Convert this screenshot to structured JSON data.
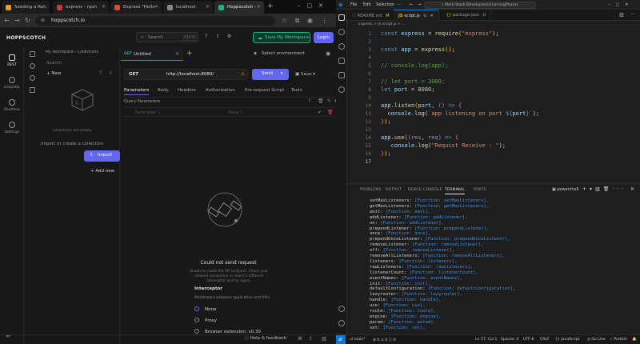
{
  "browser": {
    "tabs": [
      {
        "label": "Seeding a Re..."
      },
      {
        "label": "express - npm"
      },
      {
        "label": "Express \"Hello"
      },
      {
        "label": "localhost"
      },
      {
        "label": "Hoppscotch -"
      }
    ],
    "new_tab": "+",
    "url": "hoppscotch.io"
  },
  "hopp": {
    "logo": "HOPPSCOTCH",
    "search_label": "Search",
    "search_kbd": "Ctrl K",
    "save_workspace": "Save My Workspace",
    "login": "Login",
    "nav": [
      {
        "label": "REST"
      },
      {
        "label": "GraphQL"
      },
      {
        "label": "Realtime"
      },
      {
        "label": "Settings"
      }
    ],
    "collections": {
      "crumb_ws": "My Workspace",
      "crumb_sep": "›",
      "crumb_col": "Collections",
      "search": "Search",
      "new": "New",
      "empty": "Collections are empty",
      "import_create": "Import or create a collection",
      "import_btn": "Import",
      "add_new": "Add new"
    },
    "request": {
      "tab_method": "GET",
      "tab_name": "Untitled",
      "new_tab": "+",
      "env": "Select environment",
      "method": "GET",
      "url": "http://localhost:8080/",
      "send": "Send",
      "save": "Save",
      "tabs": [
        "Parameters",
        "Body",
        "Headers",
        "Authorization",
        "Pre-request Script",
        "Tests"
      ],
      "query_params": "Query Parameters",
      "param_key": "Parameter 1",
      "param_value": "Value 1",
      "error_title": "Could not send request",
      "error_desc": "Unable to reach the API endpoint. Check your network connection or select a different Interceptor and try again.",
      "interceptor_title": "Interceptor",
      "interceptor_desc": "Middleware between application and APIs.",
      "options": [
        "None",
        "Proxy",
        "Browser extension: v0.30"
      ]
    },
    "footer_help": "Help & feedback"
  },
  "vscode": {
    "menus": [
      "File",
      "Edit",
      "Selection"
    ],
    "command_center": "Mern-Stack-Development-LerningPhases",
    "tabs": [
      {
        "label": "README.md",
        "badge": "M"
      },
      {
        "label": "script.js",
        "badge": "U"
      },
      {
        "label": "package.json",
        "badge": "U"
      }
    ],
    "breadcrumb": "Express > JS script.js > ...",
    "code_lines": [
      "1",
      "2",
      "3",
      "4",
      "5",
      "6",
      "7",
      "8",
      "9",
      "10",
      "11",
      "12",
      "13",
      "14",
      "15",
      "16",
      "17"
    ],
    "panel_tabs": [
      "PROBLEMS",
      "OUTPUT",
      "DEBUG CONSOLE",
      "TERMINAL",
      "PORTS"
    ],
    "shell": "powershell",
    "terminal": [
      [
        "setMaxListeners: ",
        "[Function: setMaxListeners],"
      ],
      [
        "getMaxListeners: ",
        "[Function: getMaxListeners],"
      ],
      [
        "emit: ",
        "[Function: emit],"
      ],
      [
        "addListener: ",
        "[Function: addListener],"
      ],
      [
        "on: ",
        "[Function: addListener],"
      ],
      [
        "prependListener: ",
        "[Function: prependListener],"
      ],
      [
        "once: ",
        "[Function: once],"
      ],
      [
        "prependOnceListener: ",
        "[Function: prependOnceListener],"
      ],
      [
        "removeListener: ",
        "[Function: removeListener],"
      ],
      [
        "off: ",
        "[Function: removeListener],"
      ],
      [
        "removeAllListeners: ",
        "[Function: removeAllListeners],"
      ],
      [
        "listeners: ",
        "[Function: listeners],"
      ],
      [
        "rawListeners: ",
        "[Function: rawListeners],"
      ],
      [
        "listenerCount: ",
        "[Function: listenerCount],"
      ],
      [
        "eventNames: ",
        "[Function: eventNames],"
      ],
      [
        "init: ",
        "[Function: init],"
      ],
      [
        "defaultConfiguration: ",
        "[Function: defaultConfiguration],"
      ],
      [
        "lazyrouter: ",
        "[Function: lazyrouter],"
      ],
      [
        "handle: ",
        "[Function: handle],"
      ],
      [
        "use: ",
        "[Function: use],"
      ],
      [
        "route: ",
        "[Function: route],"
      ],
      [
        "engine: ",
        "[Function: engine],"
      ],
      [
        "param: ",
        "[Function: param],"
      ],
      [
        "set: ",
        "[Function: set],"
      ]
    ],
    "status": {
      "branch": "main*",
      "errors": "0",
      "warnings": "0",
      "info": "0",
      "position": "Ln 17, Col 1",
      "spaces": "Spaces: 4",
      "encoding": "UTF-8",
      "eol": "CRLF",
      "language": "{} JavaScript",
      "golive": "Go Live",
      "prettier": "✓ Prettier"
    }
  },
  "colors": {
    "accent_indigo": "#6366f1",
    "accent_green": "#10b981",
    "vscode_blue": "#0078d4"
  }
}
